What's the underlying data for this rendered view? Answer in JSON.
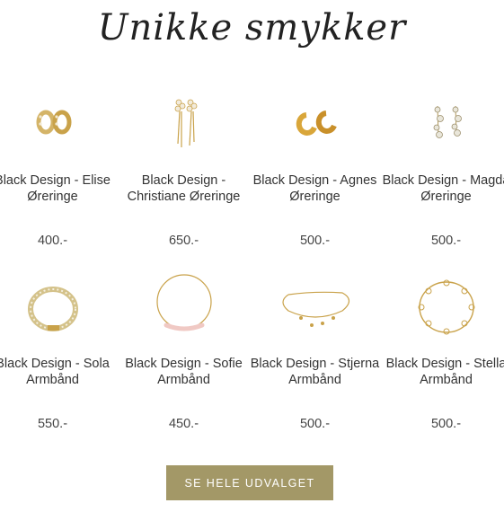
{
  "section": {
    "title": "Unikke smykker"
  },
  "products": [
    {
      "name": "Black Design - Elise Øreringe",
      "price": "400.-",
      "icon": "hoop-earrings-icon"
    },
    {
      "name": "Black Design - Christiane Øreringe",
      "price": "650.-",
      "icon": "drop-earrings-icon"
    },
    {
      "name": "Black Design - Agnes Øreringe",
      "price": "500.-",
      "icon": "gold-hoop-earrings-icon"
    },
    {
      "name": "Black Design - Magda Øreringe",
      "price": "500.-",
      "icon": "pearl-earrings-icon"
    },
    {
      "name": "Black Design - Sola Armbånd",
      "price": "550.-",
      "icon": "tennis-bracelet-icon"
    },
    {
      "name": "Black Design - Sofie Armbånd",
      "price": "450.-",
      "icon": "bar-bracelet-icon"
    },
    {
      "name": "Black Design - Stjerna Armbånd",
      "price": "500.-",
      "icon": "charm-bracelet-icon"
    },
    {
      "name": "Black Design - Stella Armbånd",
      "price": "500.-",
      "icon": "chain-bracelet-icon"
    }
  ],
  "cta": {
    "label": "SE HELE UDVALGET"
  },
  "colors": {
    "accent": "#a39867",
    "gold": "#c9a24a",
    "text": "#333333"
  }
}
